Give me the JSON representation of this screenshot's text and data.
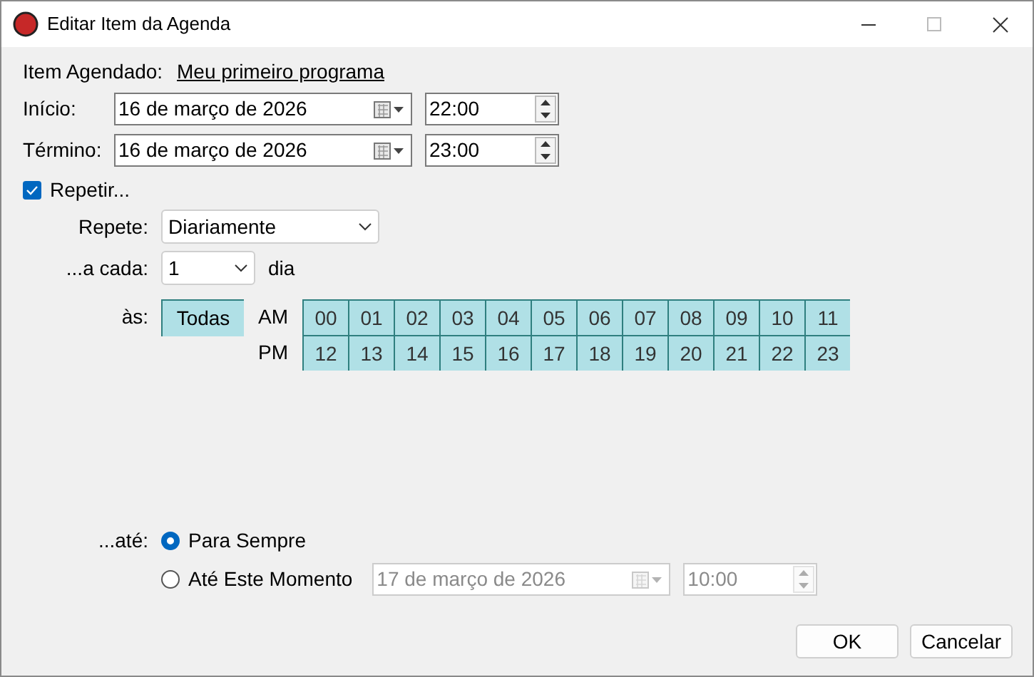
{
  "window": {
    "title": "Editar Item da Agenda"
  },
  "item": {
    "label": "Item Agendado:",
    "link": "Meu primeiro programa"
  },
  "start": {
    "label": "Início:",
    "date": "16 de março de 2026",
    "time": "22:00"
  },
  "end": {
    "label": "Término:",
    "date": "16 de março de 2026",
    "time": "23:00"
  },
  "repeat": {
    "label": "Repetir...",
    "checked": true
  },
  "repete": {
    "label": "Repete:",
    "value": "Diariamente"
  },
  "every": {
    "label": "...a cada:",
    "value": "1",
    "unit": "dia"
  },
  "at": {
    "label": "às:",
    "all": {
      "label": "Todas",
      "selected": true
    },
    "rows": [
      {
        "label": "AM",
        "hours": [
          {
            "label": "00",
            "selected": true
          },
          {
            "label": "01",
            "selected": true
          },
          {
            "label": "02",
            "selected": true
          },
          {
            "label": "03",
            "selected": true
          },
          {
            "label": "04",
            "selected": true
          },
          {
            "label": "05",
            "selected": true
          },
          {
            "label": "06",
            "selected": true
          },
          {
            "label": "07",
            "selected": true
          },
          {
            "label": "08",
            "selected": true
          },
          {
            "label": "09",
            "selected": true
          },
          {
            "label": "10",
            "selected": true
          },
          {
            "label": "11",
            "selected": true
          }
        ]
      },
      {
        "label": "PM",
        "hours": [
          {
            "label": "12",
            "selected": true
          },
          {
            "label": "13",
            "selected": true
          },
          {
            "label": "14",
            "selected": true
          },
          {
            "label": "15",
            "selected": true
          },
          {
            "label": "16",
            "selected": true
          },
          {
            "label": "17",
            "selected": true
          },
          {
            "label": "18",
            "selected": true
          },
          {
            "label": "19",
            "selected": true
          },
          {
            "label": "20",
            "selected": true
          },
          {
            "label": "21",
            "selected": true
          },
          {
            "label": "22",
            "selected": true
          },
          {
            "label": "23",
            "selected": true
          }
        ]
      }
    ]
  },
  "until": {
    "label": "...até:",
    "options": [
      {
        "label": "Para Sempre",
        "selected": true
      },
      {
        "label": "Até Este Momento",
        "selected": false
      }
    ],
    "date": "17 de março de 2026",
    "time": "10:00",
    "disabled": true
  },
  "buttons": [
    "OK",
    "Cancelar"
  ]
}
